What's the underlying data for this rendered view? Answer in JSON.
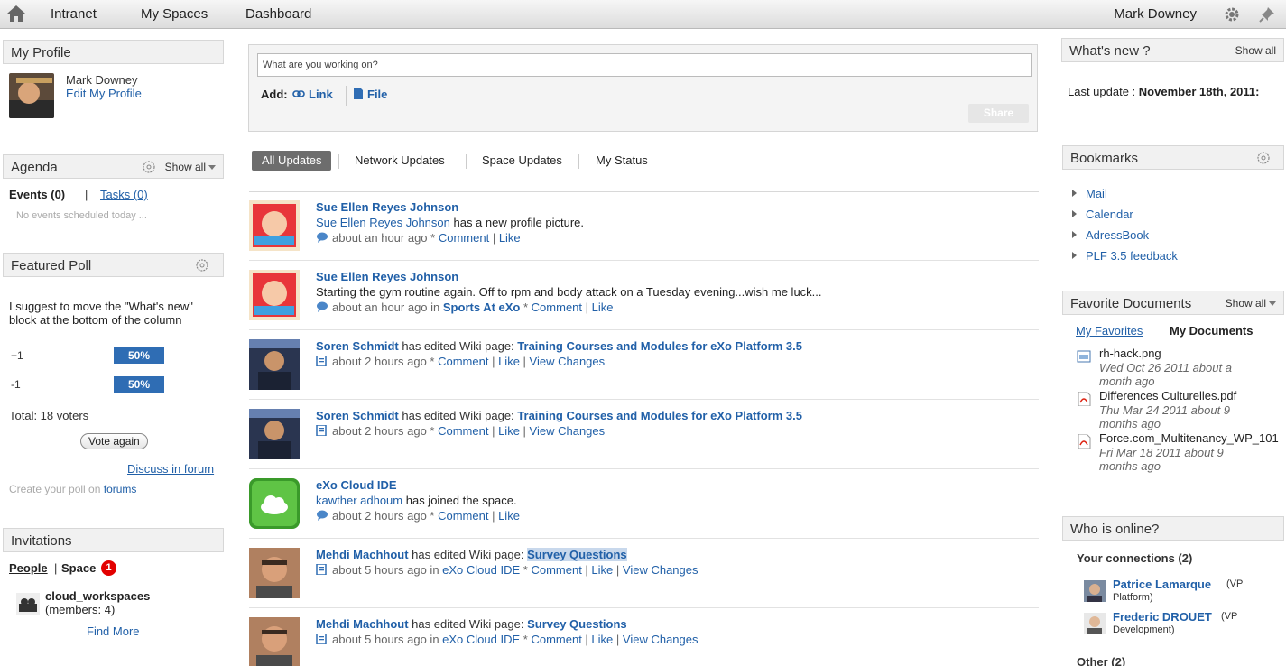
{
  "topnav": {
    "items": [
      "Intranet",
      "My Spaces",
      "Dashboard"
    ],
    "user": "Mark Downey"
  },
  "profile": {
    "header": "My Profile",
    "name": "Mark Downey",
    "edit": "Edit My Profile"
  },
  "agenda": {
    "header": "Agenda",
    "show_all": "Show all",
    "events": "Events (0)",
    "sep": "|",
    "tasks": "Tasks (0)",
    "empty": "No events scheduled today ..."
  },
  "poll": {
    "header": "Featured Poll",
    "question": "I suggest to move the \"What's new\" block at the bottom of the column",
    "options": [
      {
        "label": "+1",
        "percent": "50%"
      },
      {
        "label": "-1",
        "percent": "50%"
      }
    ],
    "total": "Total: 18 voters",
    "vote_again": "Vote again",
    "discuss": "Discuss in forum",
    "create_prefix": "Create your poll on",
    "create_link": "forums"
  },
  "invitations": {
    "header": "Invitations",
    "people": "People",
    "sep": "|",
    "space": "Space",
    "count": "1",
    "item_name": "cloud_workspaces",
    "item_members": "(members: 4)",
    "find_more": "Find More"
  },
  "composer": {
    "placeholder": "What are you working on?",
    "add": "Add:",
    "link": "Link",
    "file": "File",
    "share": "Share"
  },
  "tabs": [
    "All Updates",
    "Network Updates",
    "Space Updates",
    "My Status"
  ],
  "activities": [
    {
      "author": "Sue Ellen Reyes Johnson",
      "title_rest": "",
      "title_link": "",
      "body_link": "Sue Ellen Reyes Johnson",
      "body": " has a new profile picture.",
      "time": "about an hour ago",
      "in_prefix": "",
      "in_space": "",
      "actions": [
        "Comment",
        "Like"
      ]
    },
    {
      "author": "Sue Ellen Reyes Johnson",
      "title_rest": "",
      "title_link": "",
      "body_link": "",
      "body": "Starting the gym routine again. Off to rpm and body attack on a Tuesday evening...wish me luck...",
      "time": "about an hour ago",
      "in_prefix": " in ",
      "in_space": "Sports At eXo",
      "actions": [
        "Comment",
        "Like"
      ]
    },
    {
      "author": "Soren Schmidt",
      "title_rest": " has edited Wiki page: ",
      "title_link": "Training Courses and Modules for eXo Platform 3.5",
      "body_link": "",
      "body": "",
      "time": "about 2 hours ago",
      "in_prefix": "",
      "in_space": "",
      "actions": [
        "Comment",
        "Like",
        "View Changes"
      ]
    },
    {
      "author": "Soren Schmidt",
      "title_rest": " has edited Wiki page: ",
      "title_link": "Training Courses and Modules for eXo Platform 3.5",
      "body_link": "",
      "body": "",
      "time": "about 2 hours ago",
      "in_prefix": "",
      "in_space": "",
      "actions": [
        "Comment",
        "Like",
        "View Changes"
      ]
    },
    {
      "author": "eXo Cloud IDE",
      "title_rest": "",
      "title_link": "",
      "body_link": "kawther adhoum",
      "body": " has joined the space.",
      "time": "about 2 hours ago",
      "in_prefix": "",
      "in_space": "",
      "actions": [
        "Comment",
        "Like"
      ]
    },
    {
      "author": "Mehdi Machhout",
      "title_rest": " has edited Wiki page: ",
      "title_link": "Survey Questions",
      "body_link": "",
      "body": "",
      "time": "about 5 hours ago",
      "in_prefix": " in ",
      "in_space": "eXo Cloud IDE",
      "actions": [
        "Comment",
        "Like",
        "View Changes"
      ]
    },
    {
      "author": "Mehdi Machhout",
      "title_rest": " has edited Wiki page: ",
      "title_link": "Survey Questions",
      "body_link": "",
      "body": "",
      "time": "about 5 hours ago",
      "in_prefix": " in ",
      "in_space": "eXo Cloud IDE",
      "actions": [
        "Comment",
        "Like",
        "View Changes"
      ]
    }
  ],
  "whatsnew": {
    "header": "What's new ?",
    "show_all": "Show all",
    "last_update_label": "Last update :",
    "last_update_value": "November 18th, 2011:"
  },
  "bookmarks": {
    "header": "Bookmarks",
    "items": [
      "Mail",
      "Calendar",
      "AdressBook",
      "PLF 3.5 feedback"
    ]
  },
  "favdocs": {
    "header": "Favorite Documents",
    "show_all": "Show all",
    "tab_favorites": "My Favorites",
    "tab_documents": "My Documents",
    "items": [
      {
        "name": "rh-hack.png",
        "date": "Wed Oct 26 2011 about a month ago"
      },
      {
        "name": "Differences Culturelles.pdf",
        "date": "Thu Mar 24 2011 about 9 months ago"
      },
      {
        "name": "Force.com_Multitenancy_WP_101",
        "date": "Fri Mar 18 2011 about 9 months ago"
      }
    ]
  },
  "online": {
    "header": "Who is online?",
    "connections": "Your connections (2)",
    "people": [
      {
        "name": "Patrice Lamarque",
        "role": "(VP Platform)"
      },
      {
        "name": "Frederic DROUET",
        "role": "(VP Development)"
      }
    ],
    "other": "Other (2)"
  },
  "colors": {
    "link": "#2160a8",
    "poll_bar": "#2f6db4",
    "badge": "#e20000"
  }
}
